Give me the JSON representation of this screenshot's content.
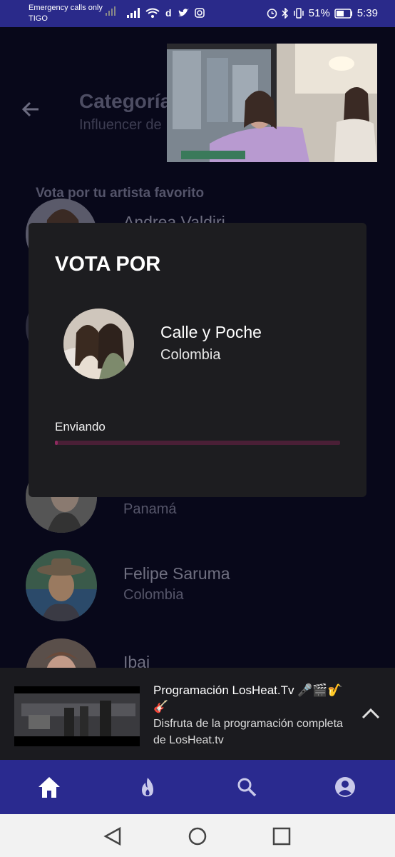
{
  "status_bar": {
    "carrier_line1": "Emergency calls only",
    "carrier_line2": "TIGO",
    "battery": "51%",
    "time": "5:39"
  },
  "header": {
    "title": "Categoría",
    "subtitle": "Influencer de",
    "back_icon": "arrow-left-icon"
  },
  "vote_prompt": "Vota por tu artista favorito",
  "artists": [
    {
      "name": "Andrea Valdiri",
      "country": ""
    },
    {
      "name": "",
      "country": "Panamá"
    },
    {
      "name": "Felipe Saruma",
      "country": "Colombia"
    },
    {
      "name": "Ibai",
      "country": ""
    }
  ],
  "modal": {
    "title": "VOTA POR",
    "artist_name": "Calle y Poche",
    "artist_country": "Colombia",
    "status_text": "Enviando",
    "progress_fraction": 0.01
  },
  "player": {
    "title": "Programación LosHeat.Tv 🎤🎬🎷🎸",
    "description": "Disfruta de la programación completa de LosHeat.tv"
  },
  "nav": {
    "items": [
      "home-icon",
      "fire-icon",
      "search-icon",
      "account-icon"
    ],
    "active": "home-icon"
  },
  "colors": {
    "nav_bg": "#2a2a8f",
    "accent_progress": "#8e2a5f"
  }
}
